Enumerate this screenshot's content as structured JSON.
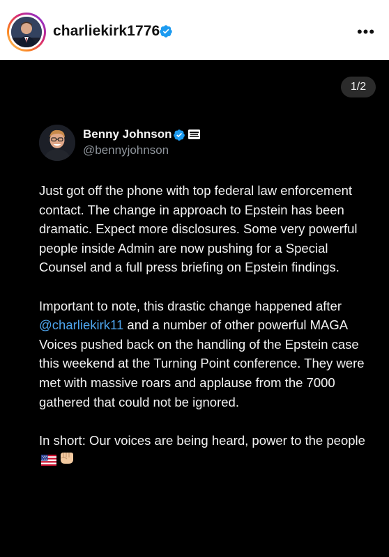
{
  "header": {
    "username": "charliekirk1776",
    "more_label": "•••"
  },
  "post": {
    "page_counter": "1/2",
    "tweet": {
      "author_name": "Benny Johnson",
      "author_handle": "@bennyjohnson",
      "paragraph_1": "Just got off the phone with top federal law enforcement contact. The change in approach to Epstein has been dramatic. Expect more disclosures. Some very powerful people inside Admin are now pushing for a Special Counsel and a full press briefing on Epstein findings.",
      "paragraph_2_before": "Important to note, this drastic change happened after ",
      "paragraph_2_mention": "@charliekirk11",
      "paragraph_2_after": " and a number of other powerful MAGA Voices pushed back on the handling of the Epstein case this weekend at the Turning Point conference. They were met with massive roars and applause from the 7000 gathered that could not be ignored.",
      "paragraph_3": "In short: Our voices are being heard, power to the people"
    }
  },
  "colors": {
    "verified_blue": "#1d9bf0",
    "mention_blue": "#4ea5ee",
    "post_background": "#000000"
  },
  "icons": {
    "verified": "verified-badge-icon",
    "more": "more-options-icon",
    "flag": "us-flag-icon",
    "fist": "raised-fist-icon"
  }
}
